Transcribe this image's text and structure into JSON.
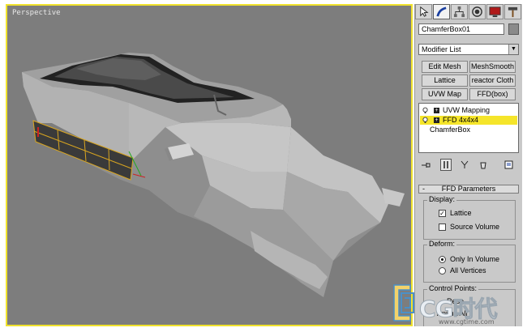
{
  "viewport": {
    "label": "Perspective"
  },
  "panel": {
    "tabs": [
      {
        "icon": "create-cursor-icon"
      },
      {
        "icon": "modify-bend-icon"
      },
      {
        "icon": "hierarchy-icon"
      },
      {
        "icon": "motion-icon"
      },
      {
        "icon": "display-monitor-icon"
      },
      {
        "icon": "utilities-hammer-icon"
      }
    ],
    "object_name": "ChamferBox01",
    "modifier_list": "Modifier List",
    "buttons": [
      "Edit Mesh",
      "MeshSmooth",
      "Lattice",
      "reactor Cloth",
      "UVW Map",
      "FFD(box)"
    ],
    "stack": [
      {
        "label": "UVW Mapping",
        "selected": false
      },
      {
        "label": "FFD 4x4x4",
        "selected": true
      },
      {
        "label": "ChamferBox",
        "selected": false
      }
    ],
    "rollout": {
      "title": "FFD Parameters",
      "collapse": "-",
      "display": {
        "title": "Display:",
        "lattice": "Lattice",
        "source_volume": "Source Volume",
        "check_mark": "✓"
      },
      "deform": {
        "title": "Deform:",
        "only_in_volume": "Only In Volume",
        "all_vertices": "All Vertices"
      },
      "control_points": {
        "title": "Control Points:",
        "partial_1": "Rese",
        "partial_2": "Anima All"
      }
    }
  },
  "watermark": {
    "text": "CG时代",
    "url": "www.cgtime.com"
  },
  "colors": {
    "viewport_border": "#f0e22c",
    "viewport_bg": "#7d7d7d",
    "selection": "#f5e52a"
  }
}
